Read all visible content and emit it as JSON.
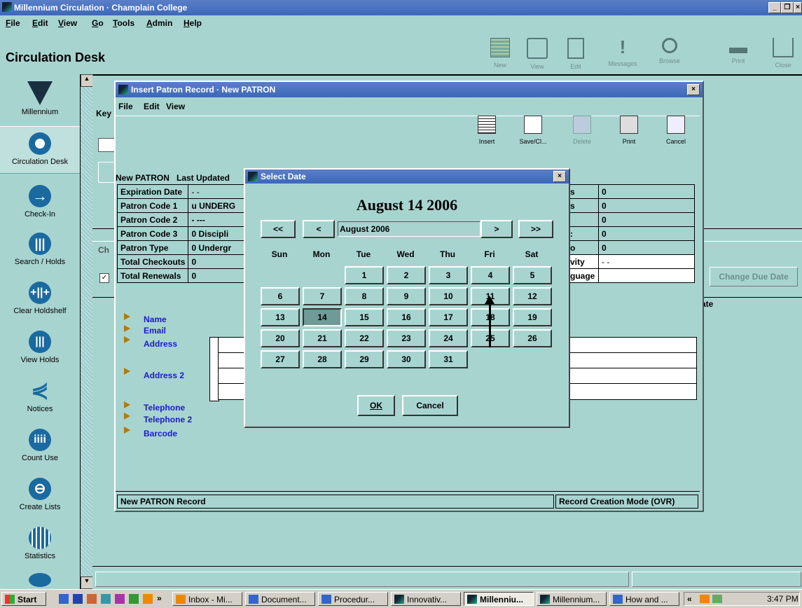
{
  "window": {
    "title": "Millennium Circulation · Champlain College"
  },
  "menubar": {
    "items": [
      "File",
      "Edit",
      "View",
      "Go",
      "Tools",
      "Admin",
      "Help"
    ]
  },
  "header": {
    "title": "Circulation Desk",
    "toolbar": [
      "New",
      "View",
      "Edit",
      "Messages",
      "Browse",
      "Print",
      "Close"
    ]
  },
  "leftnav": {
    "items": [
      "Millennium",
      "Circulation Desk",
      "Check-In",
      "Search / Holds",
      "Clear Holdshelf",
      "View Holds",
      "Notices",
      "Count Use",
      "Create Lists",
      "Statistics"
    ]
  },
  "background": {
    "key_label": "Key",
    "tab_label": "Ch",
    "change_due_date": "Change Due Date",
    "date_col": "ate"
  },
  "patron_window": {
    "title": "Insert Patron Record · New PATRON",
    "menu": [
      "File",
      "Edit",
      "View"
    ],
    "toolbar": [
      "Insert",
      "Save/Cl...",
      "Delete",
      "Print",
      "Cancel"
    ],
    "header_left": "New PATRON",
    "header_last_updated": "Last Updated",
    "fields": [
      {
        "label": "Expiration Date",
        "value": "- -"
      },
      {
        "label": "Patron Code 1",
        "value": "u  UNDERG"
      },
      {
        "label": "Patron Code 2",
        "value": "-  ---"
      },
      {
        "label": "Patron Code 3",
        "value": "0  Discipli"
      },
      {
        "label": "Patron Type",
        "value": "0  Undergr"
      },
      {
        "label": "Total Checkouts",
        "value": "0"
      },
      {
        "label": "Total Renewals",
        "value": "0"
      }
    ],
    "right_fields": [
      {
        "label": "s",
        "value": "0"
      },
      {
        "label": "s",
        "value": "0"
      },
      {
        "label": "",
        "value": "0"
      },
      {
        "label": ":",
        "value": "0"
      },
      {
        "label": "o",
        "value": "0"
      },
      {
        "label": "vity",
        "value": "- -"
      },
      {
        "label": "guage",
        "value": ""
      }
    ],
    "var_fields": [
      "Name",
      "Email",
      "Address",
      "Address 2",
      "Telephone",
      "Telephone 2",
      "Barcode"
    ],
    "status_left": "New PATRON Record",
    "status_right": "Record Creation Mode (OVR)"
  },
  "date_dialog": {
    "title": "Select Date",
    "heading": "August 14 2006",
    "month_label": "August  2006",
    "nav": {
      "prev_year": "<<",
      "prev": "<",
      "next": ">",
      "next_year": ">>"
    },
    "weekdays": [
      "Sun",
      "Mon",
      "Tue",
      "Wed",
      "Thu",
      "Fri",
      "Sat"
    ],
    "first_weekday_index": 2,
    "days_in_month": 31,
    "selected_day": 14,
    "ok": "OK",
    "cancel": "Cancel"
  },
  "taskbar": {
    "start": "Start",
    "tasks": [
      "Inbox - Mi...",
      "Document...",
      "Procedur...",
      "Innovativ...",
      "Millenniu...",
      "Millennium...",
      "How and ..."
    ],
    "active_task_index": 4,
    "clock": "3:47 PM",
    "chevron": "«",
    "quick_chevron": "»"
  }
}
